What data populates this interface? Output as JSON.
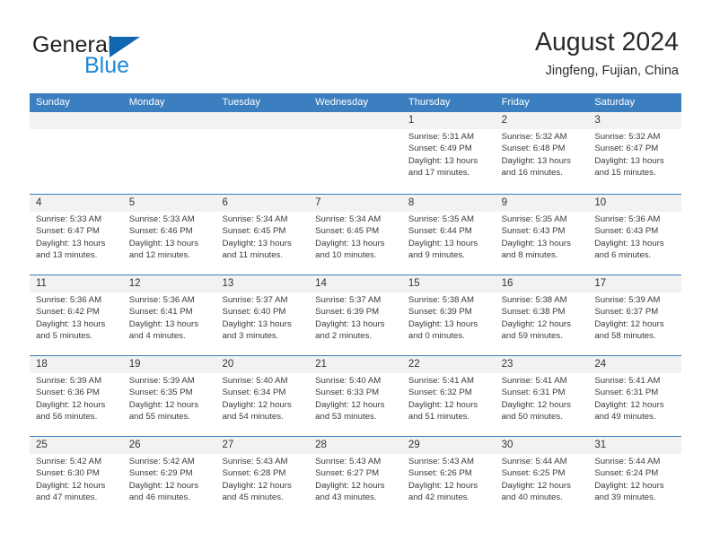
{
  "brand": {
    "name_part1": "General",
    "name_part2": "Blue",
    "triangle_color": "#1166b0",
    "blue_color": "#1e87d6"
  },
  "header": {
    "title": "August 2024",
    "subtitle": "Jingfeng, Fujian, China"
  },
  "theme": {
    "header_row_bg": "#3c7fc0",
    "day_band_bg": "#f2f2f2",
    "cell_border": "#3c7fc0",
    "text": "#3b3b3b"
  },
  "weekday_headers": [
    "Sunday",
    "Monday",
    "Tuesday",
    "Wednesday",
    "Thursday",
    "Friday",
    "Saturday"
  ],
  "weeks": [
    [
      {
        "day": "",
        "lines": []
      },
      {
        "day": "",
        "lines": []
      },
      {
        "day": "",
        "lines": []
      },
      {
        "day": "",
        "lines": []
      },
      {
        "day": "1",
        "lines": [
          "Sunrise: 5:31 AM",
          "Sunset: 6:49 PM",
          "Daylight: 13 hours",
          "and 17 minutes."
        ]
      },
      {
        "day": "2",
        "lines": [
          "Sunrise: 5:32 AM",
          "Sunset: 6:48 PM",
          "Daylight: 13 hours",
          "and 16 minutes."
        ]
      },
      {
        "day": "3",
        "lines": [
          "Sunrise: 5:32 AM",
          "Sunset: 6:47 PM",
          "Daylight: 13 hours",
          "and 15 minutes."
        ]
      }
    ],
    [
      {
        "day": "4",
        "lines": [
          "Sunrise: 5:33 AM",
          "Sunset: 6:47 PM",
          "Daylight: 13 hours",
          "and 13 minutes."
        ]
      },
      {
        "day": "5",
        "lines": [
          "Sunrise: 5:33 AM",
          "Sunset: 6:46 PM",
          "Daylight: 13 hours",
          "and 12 minutes."
        ]
      },
      {
        "day": "6",
        "lines": [
          "Sunrise: 5:34 AM",
          "Sunset: 6:45 PM",
          "Daylight: 13 hours",
          "and 11 minutes."
        ]
      },
      {
        "day": "7",
        "lines": [
          "Sunrise: 5:34 AM",
          "Sunset: 6:45 PM",
          "Daylight: 13 hours",
          "and 10 minutes."
        ]
      },
      {
        "day": "8",
        "lines": [
          "Sunrise: 5:35 AM",
          "Sunset: 6:44 PM",
          "Daylight: 13 hours",
          "and 9 minutes."
        ]
      },
      {
        "day": "9",
        "lines": [
          "Sunrise: 5:35 AM",
          "Sunset: 6:43 PM",
          "Daylight: 13 hours",
          "and 8 minutes."
        ]
      },
      {
        "day": "10",
        "lines": [
          "Sunrise: 5:36 AM",
          "Sunset: 6:43 PM",
          "Daylight: 13 hours",
          "and 6 minutes."
        ]
      }
    ],
    [
      {
        "day": "11",
        "lines": [
          "Sunrise: 5:36 AM",
          "Sunset: 6:42 PM",
          "Daylight: 13 hours",
          "and 5 minutes."
        ]
      },
      {
        "day": "12",
        "lines": [
          "Sunrise: 5:36 AM",
          "Sunset: 6:41 PM",
          "Daylight: 13 hours",
          "and 4 minutes."
        ]
      },
      {
        "day": "13",
        "lines": [
          "Sunrise: 5:37 AM",
          "Sunset: 6:40 PM",
          "Daylight: 13 hours",
          "and 3 minutes."
        ]
      },
      {
        "day": "14",
        "lines": [
          "Sunrise: 5:37 AM",
          "Sunset: 6:39 PM",
          "Daylight: 13 hours",
          "and 2 minutes."
        ]
      },
      {
        "day": "15",
        "lines": [
          "Sunrise: 5:38 AM",
          "Sunset: 6:39 PM",
          "Daylight: 13 hours",
          "and 0 minutes."
        ]
      },
      {
        "day": "16",
        "lines": [
          "Sunrise: 5:38 AM",
          "Sunset: 6:38 PM",
          "Daylight: 12 hours",
          "and 59 minutes."
        ]
      },
      {
        "day": "17",
        "lines": [
          "Sunrise: 5:39 AM",
          "Sunset: 6:37 PM",
          "Daylight: 12 hours",
          "and 58 minutes."
        ]
      }
    ],
    [
      {
        "day": "18",
        "lines": [
          "Sunrise: 5:39 AM",
          "Sunset: 6:36 PM",
          "Daylight: 12 hours",
          "and 56 minutes."
        ]
      },
      {
        "day": "19",
        "lines": [
          "Sunrise: 5:39 AM",
          "Sunset: 6:35 PM",
          "Daylight: 12 hours",
          "and 55 minutes."
        ]
      },
      {
        "day": "20",
        "lines": [
          "Sunrise: 5:40 AM",
          "Sunset: 6:34 PM",
          "Daylight: 12 hours",
          "and 54 minutes."
        ]
      },
      {
        "day": "21",
        "lines": [
          "Sunrise: 5:40 AM",
          "Sunset: 6:33 PM",
          "Daylight: 12 hours",
          "and 53 minutes."
        ]
      },
      {
        "day": "22",
        "lines": [
          "Sunrise: 5:41 AM",
          "Sunset: 6:32 PM",
          "Daylight: 12 hours",
          "and 51 minutes."
        ]
      },
      {
        "day": "23",
        "lines": [
          "Sunrise: 5:41 AM",
          "Sunset: 6:31 PM",
          "Daylight: 12 hours",
          "and 50 minutes."
        ]
      },
      {
        "day": "24",
        "lines": [
          "Sunrise: 5:41 AM",
          "Sunset: 6:31 PM",
          "Daylight: 12 hours",
          "and 49 minutes."
        ]
      }
    ],
    [
      {
        "day": "25",
        "lines": [
          "Sunrise: 5:42 AM",
          "Sunset: 6:30 PM",
          "Daylight: 12 hours",
          "and 47 minutes."
        ]
      },
      {
        "day": "26",
        "lines": [
          "Sunrise: 5:42 AM",
          "Sunset: 6:29 PM",
          "Daylight: 12 hours",
          "and 46 minutes."
        ]
      },
      {
        "day": "27",
        "lines": [
          "Sunrise: 5:43 AM",
          "Sunset: 6:28 PM",
          "Daylight: 12 hours",
          "and 45 minutes."
        ]
      },
      {
        "day": "28",
        "lines": [
          "Sunrise: 5:43 AM",
          "Sunset: 6:27 PM",
          "Daylight: 12 hours",
          "and 43 minutes."
        ]
      },
      {
        "day": "29",
        "lines": [
          "Sunrise: 5:43 AM",
          "Sunset: 6:26 PM",
          "Daylight: 12 hours",
          "and 42 minutes."
        ]
      },
      {
        "day": "30",
        "lines": [
          "Sunrise: 5:44 AM",
          "Sunset: 6:25 PM",
          "Daylight: 12 hours",
          "and 40 minutes."
        ]
      },
      {
        "day": "31",
        "lines": [
          "Sunrise: 5:44 AM",
          "Sunset: 6:24 PM",
          "Daylight: 12 hours",
          "and 39 minutes."
        ]
      }
    ]
  ]
}
